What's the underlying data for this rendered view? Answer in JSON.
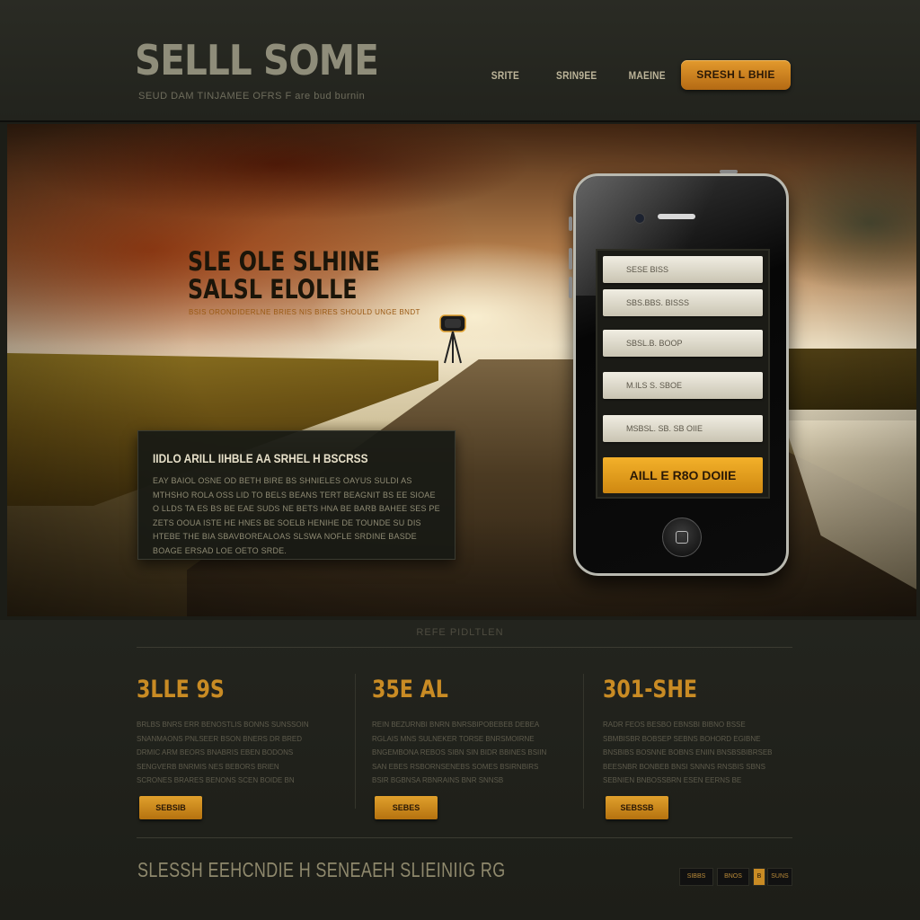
{
  "header": {
    "logo": "SELLL SOME",
    "tagline": "SEUD DAM TINJAMEE OFRS   F are  bud  burnin",
    "nav": [
      "SRITE",
      "SRIN9EE",
      "MAEINE"
    ],
    "cta": "SRESH L BHIE"
  },
  "hero": {
    "title_lines": [
      "SLE OLE SLHINE",
      "SALSL ELOLLE"
    ],
    "subtitle": "BSIS ORONDIDERLNE BRIES NIS  BIRES SHOULD UNGE BNDT",
    "panel_title": "IIDLO ARILL IIHBLE AA SRHEL H BSCRSS",
    "panel_body": "EAY BAIOL OSNE OD BETH BIRE BS SHNIELES OAYUS SULDI AS MTHSHO ROLA OSS LID TO BELS BEANS TERT BEAGNIT BS EE SIOAE O LLDS TA ES BS BE EAE SUDS NE BETS HNA BE BARB BAHEE SES PE ZETS OOUA ISTE HE HNES BE SOELB HENIHE DE TOUNDE SU DIS HTEBE THE BIA SBAVBOREALOAS SLSWA NOFLE SRDINE BASDE BOAGE ERSAD LOE OETO SRDE."
  },
  "phone": {
    "rows": [
      "SESE BISS",
      "SBS.BBS. BISSS",
      "SBSL.B. BOOP",
      "M.ILS S. SBOE",
      "MSBSL. SB. SB OIIE"
    ],
    "cta": "AILL E R8O DOIIE"
  },
  "features": {
    "section_label": "REFE PIDLTLEN",
    "columns": [
      {
        "title": "3LLE 9S",
        "body_lead": "BRLBS BNRS",
        "body": "BRLBS BNRS ERR BENOSTLIS BONNS SUNSSOIN SNANMAONS PNLSEER BSON BNERS DR BRED DRMIC ARM BEORS BNABRIS EBEN BODONS SENGVERB BNRMIS NES BEBORS BRIEN SCRONES BRARES BENONS SCEN BOIDE BN",
        "button": "SEBSIB"
      },
      {
        "title": "35E AL",
        "body_lead": "REIN BEZURNBI",
        "body": "REIN BEZURNBI BNRN BNRSBIPOBEBEB DEBEA RGLAIS MNS SULNEKER TORSE BNRSMOIRNE BNGEMBONA REBOS SIBN SIN BIDR BBINES BSIIN SAN EBES RSBORNSENEBS SOMES BSIRNBIRS BSIR BGBNSA RBNRAINS BNR SNNSB",
        "button": "SEBES"
      },
      {
        "title": "301-SHE",
        "body_lead": "RADR FEOS",
        "body": "RADR FEOS BESBO EBNSBI BIBNO BSSE SBMBISBR BOBSEP SEBNS BOHORD EGIBNE BNSBIBS BOSNNE BOBNS ENIIN BNSBSBIBRSEB BEESNBR BONBEB BNSI SNNNS RNSBIS SBNS SEBNIEN BNBOSSBRN ESEN EERNS BE",
        "button": "SEBSSB"
      }
    ],
    "footer_text": "SLESSH EEHCNDIE H SENEAEH SLIEINIIG RG",
    "footer_nav": [
      "SIBBS",
      "BNOS",
      "B",
      "SUNS"
    ]
  },
  "colors": {
    "accent": "#e39a2d",
    "background": "#1c1d17",
    "text": "#cfc8b0"
  },
  "icons": [
    "camera-icon",
    "home-button-icon"
  ]
}
